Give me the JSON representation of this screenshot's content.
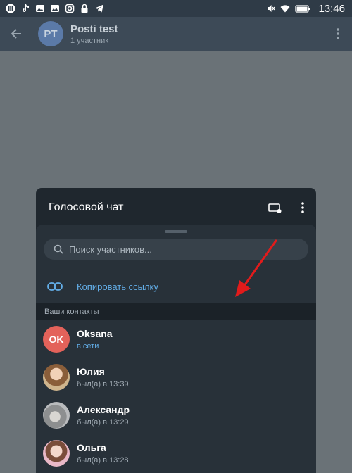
{
  "status_bar": {
    "time": "13:46",
    "left_icons": [
      "voice-icon",
      "tiktok-icon",
      "gallery-icon",
      "photo-icon",
      "instagram-icon",
      "lock-icon",
      "telegram-icon"
    ],
    "right_icons": [
      "mute-icon",
      "wifi-icon",
      "battery-icon"
    ]
  },
  "header": {
    "avatar_initials": "PT",
    "title": "Posti test",
    "subtitle": "1 участник"
  },
  "voice_chat": {
    "title": "Голосовой чат",
    "search_placeholder": "Поиск участников...",
    "copy_link_label": "Копировать ссылку",
    "section_label": "Ваши контакты",
    "contacts": [
      {
        "name": "Oksana",
        "status": "в сети",
        "initials": "OK",
        "avatar_color": "#e3625a",
        "online": true
      },
      {
        "name": "Юлия",
        "status": "был(а) в 13:39",
        "initials": "",
        "avatar_color": "#b89a6e",
        "online": false
      },
      {
        "name": "Александр",
        "status": "был(а) в 13:29",
        "initials": "",
        "avatar_color": "#9aa0a5",
        "online": false
      },
      {
        "name": "Ольга",
        "status": "был(а) в 13:28",
        "initials": "",
        "avatar_color": "#d9a7b3",
        "online": false
      }
    ]
  },
  "colors": {
    "accent": "#63aee8",
    "arrow": "#e21b1b",
    "sheet_bg": "#1f272e",
    "panel_bg": "#283139"
  }
}
